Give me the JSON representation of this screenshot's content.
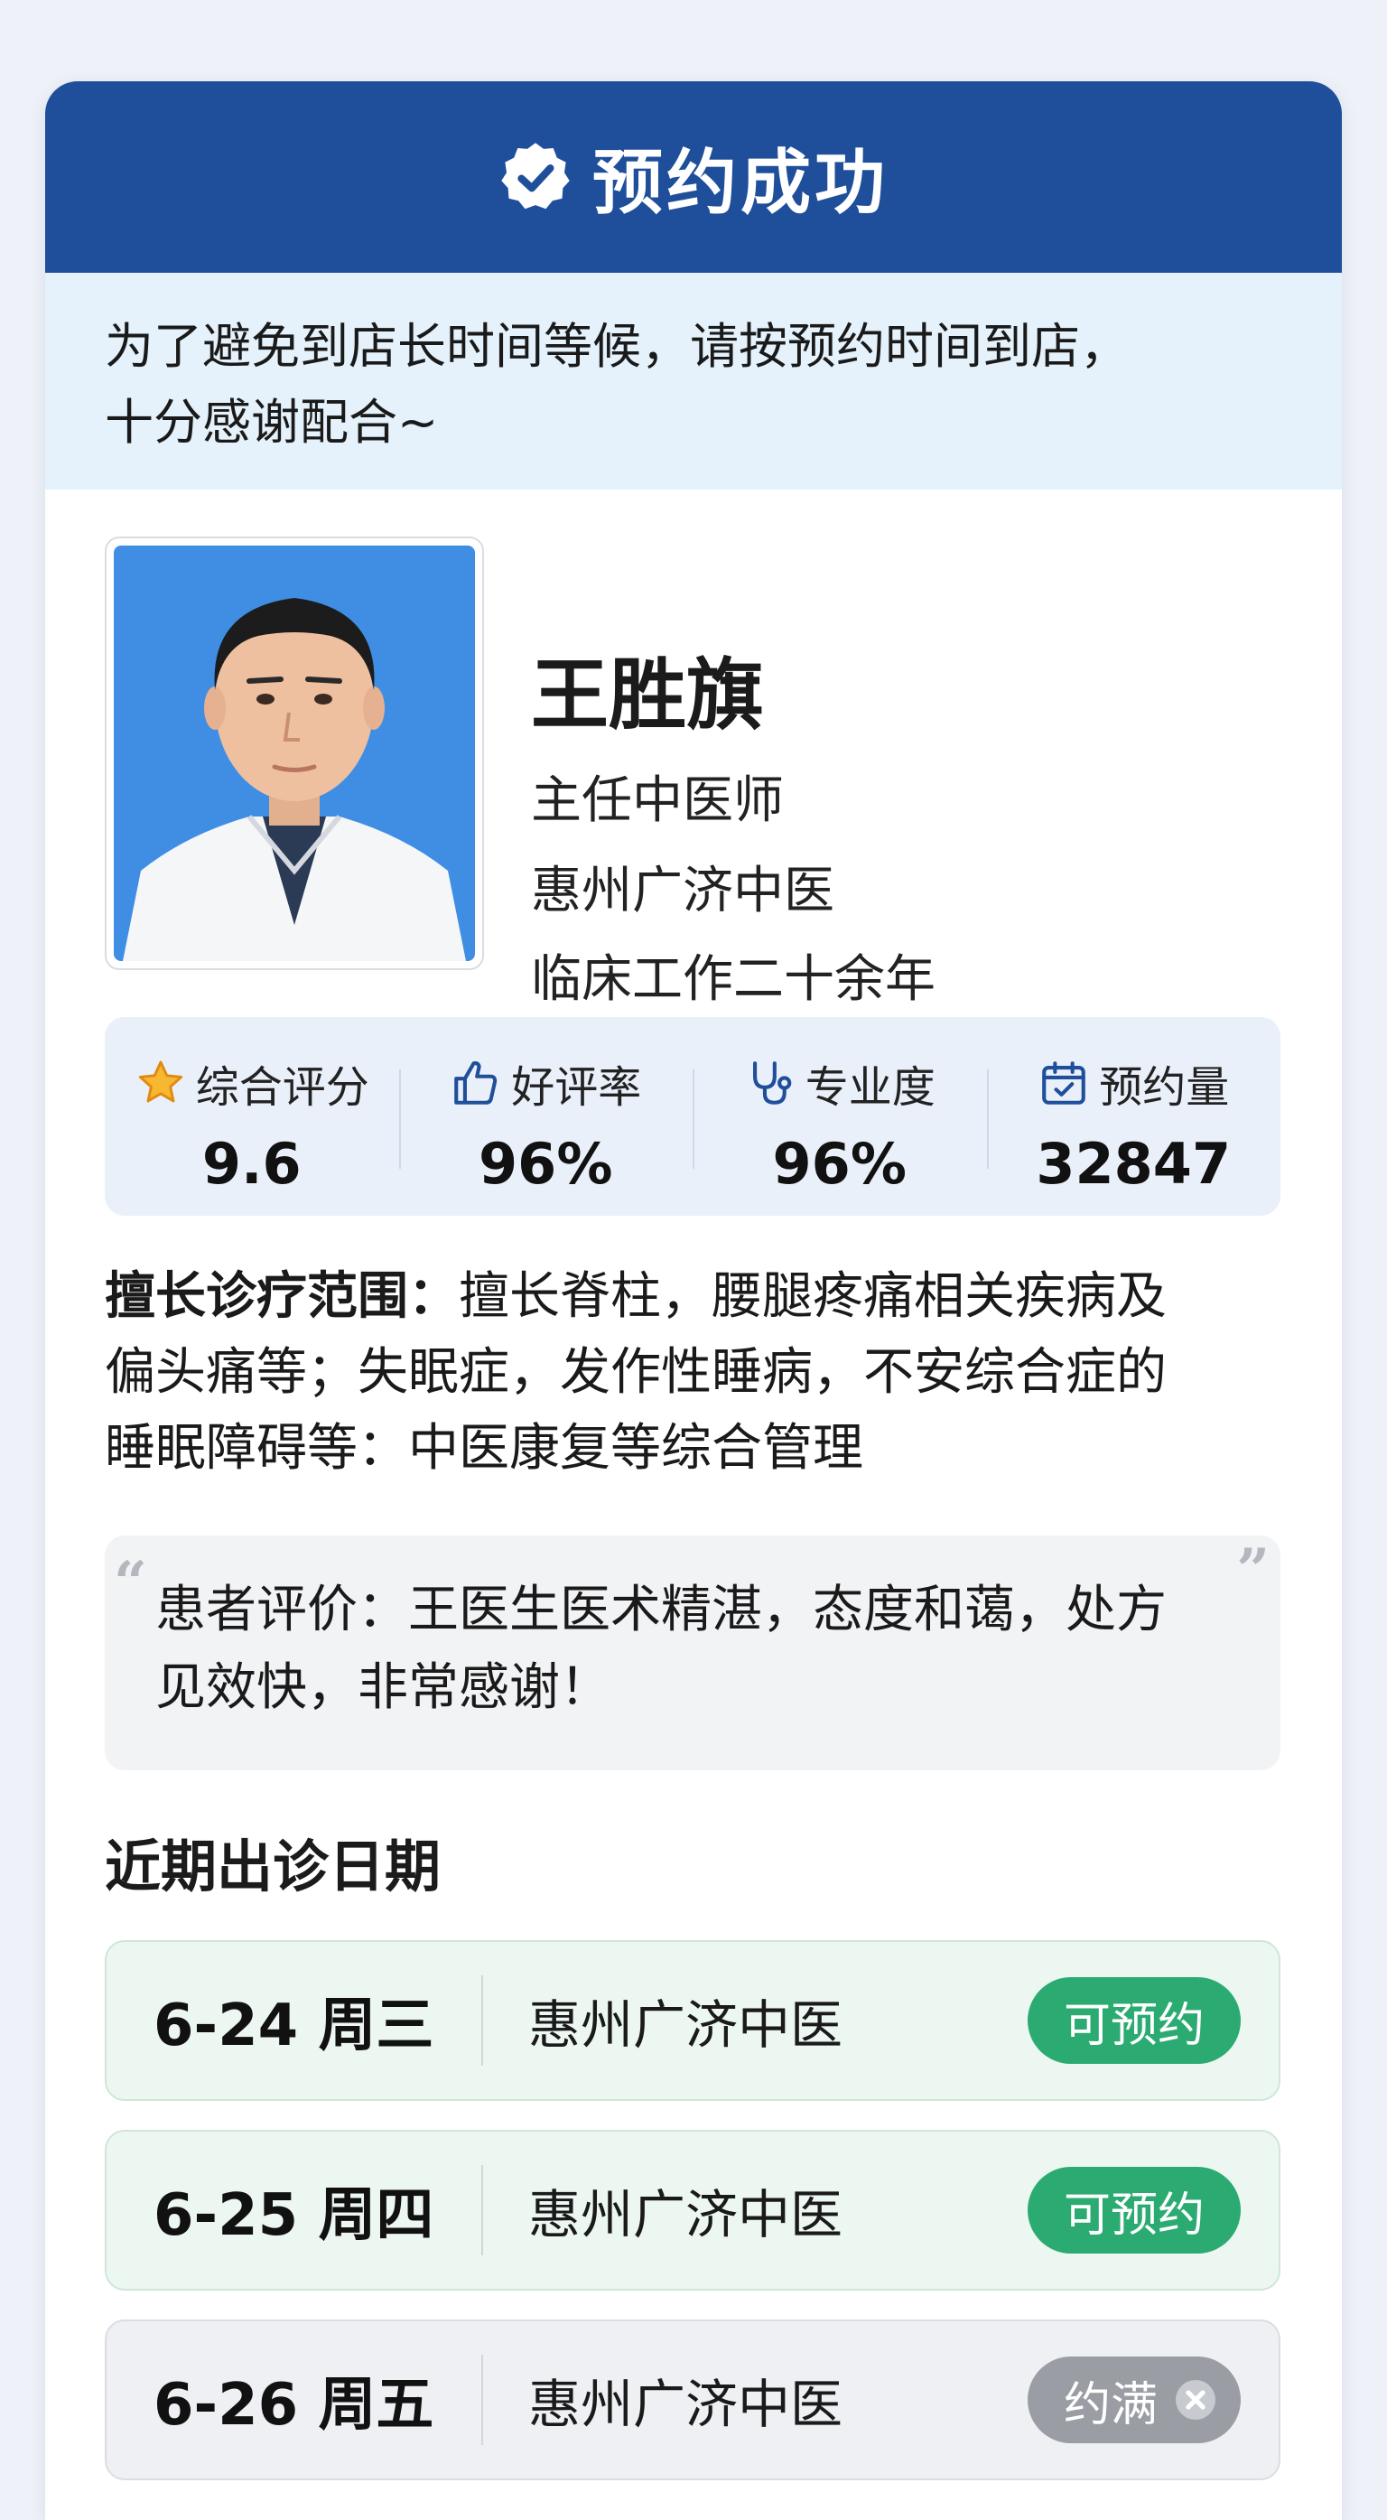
{
  "header": {
    "title": "预约成功",
    "accent": "#1f4f9a"
  },
  "notice": {
    "line1": "为了避免到店长时间等候，请按预约时间到店，",
    "line2": "十分感谢配合~"
  },
  "doctor": {
    "name": "王胜旗",
    "title": "主任中医师",
    "clinic": "惠州广济中医",
    "experience": "临床工作二十余年"
  },
  "stats": [
    {
      "icon": "star-icon",
      "label": "综合评分",
      "value": "9.6"
    },
    {
      "icon": "thumbs-up-icon",
      "label": "好评率",
      "value": "96%"
    },
    {
      "icon": "stethoscope-icon",
      "label": "专业度",
      "value": "96%"
    },
    {
      "icon": "calendar-check-icon",
      "label": "预约量",
      "value": "32847"
    }
  ],
  "specialty": {
    "label": "擅长诊疗范围：",
    "line1": "擅长脊柱，腰腿疼痛相关疾病及",
    "line2": "偏头痛等；失眠症，发作性睡病，不安综合症的",
    "line3": "睡眠障碍等：中医康复等综合管理"
  },
  "review": {
    "line1": "患者评价：王医生医术精湛，态度和蔼，处方",
    "line2": "见效快，非常感谢！"
  },
  "schedule": {
    "title": "近期出诊日期",
    "rows": [
      {
        "date": "6-24 周三",
        "clinic": "惠州广济中医",
        "status": "可预约",
        "state": "available"
      },
      {
        "date": "6-25 周四",
        "clinic": "惠州广济中医",
        "status": "可预约",
        "state": "available"
      },
      {
        "date": "6-26 周五",
        "clinic": "惠州广济中医",
        "status": "约满",
        "state": "full"
      }
    ]
  },
  "colors": {
    "available": "#2bab72",
    "full": "#9a9ea4",
    "notice_bg": "#e5f2fb"
  }
}
